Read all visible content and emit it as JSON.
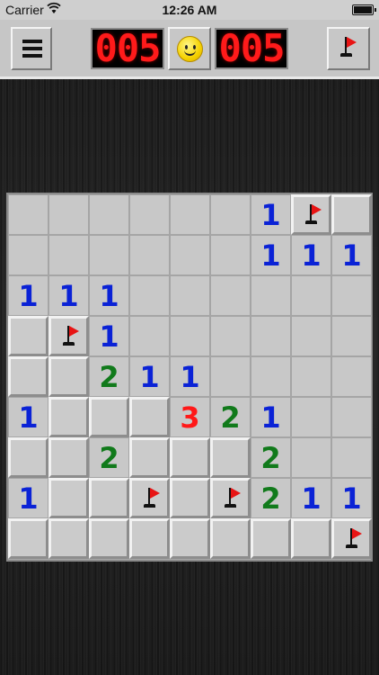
{
  "status_bar": {
    "carrier": "Carrier",
    "time": "12:26 AM"
  },
  "toolbar": {
    "mines_counter": "005",
    "timer_counter": "005"
  },
  "board": {
    "rows": 9,
    "cols": 9,
    "cells": [
      [
        "",
        "",
        "",
        "",
        "",
        "",
        "1",
        "F",
        "C"
      ],
      [
        "",
        "",
        "",
        "",
        "",
        "",
        "1",
        "1",
        "1"
      ],
      [
        "1",
        "1",
        "1",
        "",
        "",
        "",
        "",
        "",
        ""
      ],
      [
        "C",
        "F",
        "1",
        "",
        "",
        "",
        "",
        "",
        ""
      ],
      [
        "C",
        "C",
        "2",
        "1",
        "1",
        "",
        "",
        "",
        ""
      ],
      [
        "1",
        "C",
        "C",
        "C",
        "3",
        "2",
        "1",
        "",
        ""
      ],
      [
        "C",
        "C",
        "2",
        "C",
        "C",
        "C",
        "2",
        "",
        ""
      ],
      [
        "1",
        "C",
        "C",
        "F",
        "C",
        "F",
        "2",
        "1",
        "1"
      ],
      [
        "C",
        "C",
        "C",
        "C",
        "C",
        "C",
        "C",
        "C",
        "F"
      ]
    ],
    "legend": {
      "empty_string": "opened empty cell",
      "C": "closed cell",
      "F": "flagged cell"
    },
    "number_colors": {
      "1": "#0a22d6",
      "2": "#117a1b",
      "3": "#ff1818"
    }
  }
}
